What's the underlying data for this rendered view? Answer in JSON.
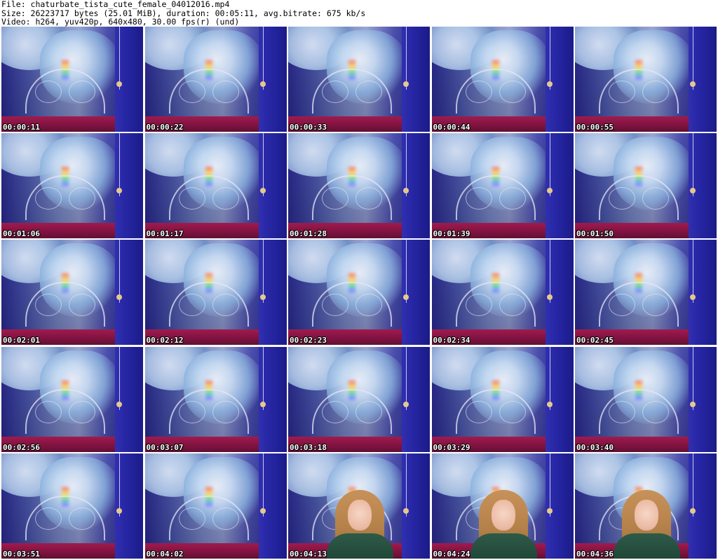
{
  "header": {
    "line1": "File: chaturbate_tista_cute_female_04012016.mp4",
    "line2": "Size: 26223717 bytes (25.01 MiB), duration: 00:05:11, avg.bitrate: 675 kb/s",
    "line3": "Video: h264, yuv420p, 640x480, 30.00 fps(r) (und)"
  },
  "frames": [
    {
      "timestamp": "00:00:11",
      "person": false
    },
    {
      "timestamp": "00:00:22",
      "person": false
    },
    {
      "timestamp": "00:00:33",
      "person": false
    },
    {
      "timestamp": "00:00:44",
      "person": false
    },
    {
      "timestamp": "00:00:55",
      "person": false
    },
    {
      "timestamp": "00:01:06",
      "person": false
    },
    {
      "timestamp": "00:01:17",
      "person": false
    },
    {
      "timestamp": "00:01:28",
      "person": false
    },
    {
      "timestamp": "00:01:39",
      "person": false
    },
    {
      "timestamp": "00:01:50",
      "person": false
    },
    {
      "timestamp": "00:02:01",
      "person": false
    },
    {
      "timestamp": "00:02:12",
      "person": false
    },
    {
      "timestamp": "00:02:23",
      "person": false
    },
    {
      "timestamp": "00:02:34",
      "person": false
    },
    {
      "timestamp": "00:02:45",
      "person": false
    },
    {
      "timestamp": "00:02:56",
      "person": false
    },
    {
      "timestamp": "00:03:07",
      "person": false
    },
    {
      "timestamp": "00:03:18",
      "person": false
    },
    {
      "timestamp": "00:03:29",
      "person": false
    },
    {
      "timestamp": "00:03:40",
      "person": false
    },
    {
      "timestamp": "00:03:51",
      "person": false
    },
    {
      "timestamp": "00:04:02",
      "person": false
    },
    {
      "timestamp": "00:04:13",
      "person": true
    },
    {
      "timestamp": "00:04:24",
      "person": true
    },
    {
      "timestamp": "00:04:36",
      "person": true
    }
  ]
}
